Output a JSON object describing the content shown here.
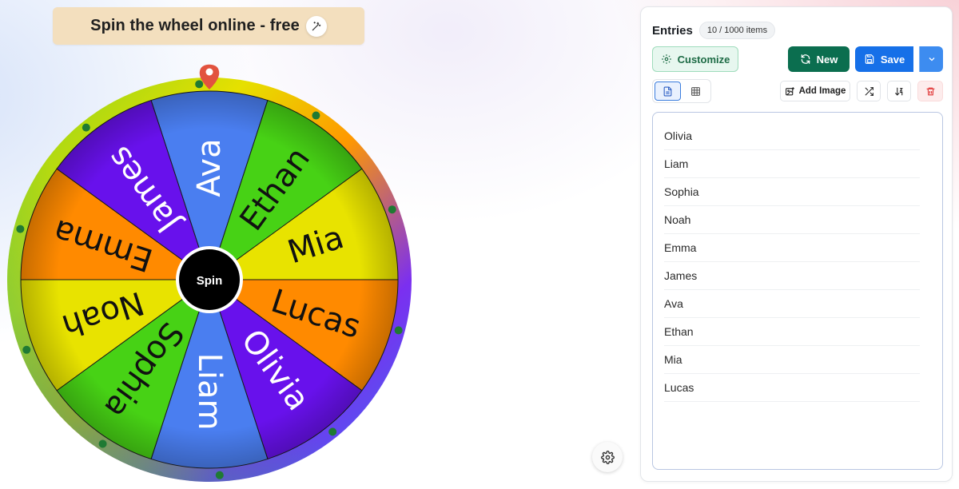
{
  "header": {
    "title": "Spin the wheel online - free",
    "magic_icon": "magic-wand-icon"
  },
  "wheel": {
    "center_label": "Spin",
    "segments": [
      {
        "label": "Ava",
        "color": "#4a7ef0"
      },
      {
        "label": "Ethan",
        "color": "#47d215"
      },
      {
        "label": "Mia",
        "color": "#e8e300"
      },
      {
        "label": "Lucas",
        "color": "#ff8a00"
      },
      {
        "label": "Olivia",
        "color": "#6811ec"
      },
      {
        "label": "Liam",
        "color": "#4a7ef0"
      },
      {
        "label": "Sophia",
        "color": "#47d215"
      },
      {
        "label": "Noah",
        "color": "#e8e300"
      },
      {
        "label": "Emma",
        "color": "#ff8a00"
      },
      {
        "label": "James",
        "color": "#6811ec"
      }
    ],
    "pointer_color": "#e2533f"
  },
  "panel": {
    "title": "Entries",
    "count": "10 / 1000 items",
    "buttons": {
      "customize": "Customize",
      "new": "New",
      "save": "Save",
      "add_image": "Add Image"
    },
    "entries": [
      "Olivia",
      "Liam",
      "Sophia",
      "Noah",
      "Emma",
      "James",
      "Ava",
      "Ethan",
      "Mia",
      "Lucas"
    ]
  },
  "colors": {
    "new_button": "#0b6e4f",
    "save_button": "#1670e8",
    "customize_bg": "#e7f7ef"
  }
}
